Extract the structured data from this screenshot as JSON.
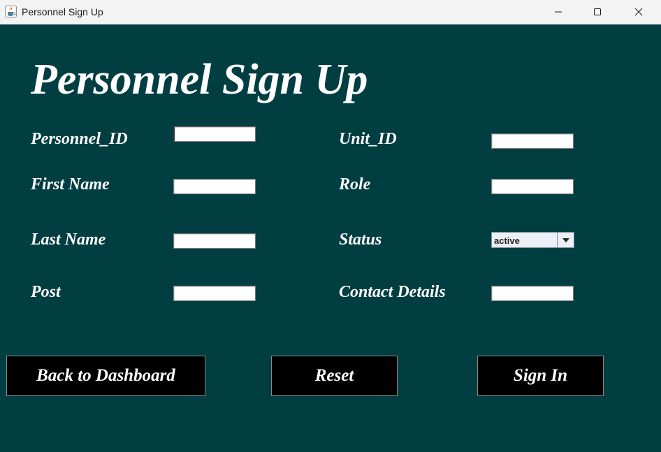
{
  "window": {
    "title": "Personnel Sign Up",
    "icon": "java-cup-icon"
  },
  "form": {
    "heading": "Personnel Sign Up",
    "fields": {
      "personnel_id": {
        "label": "Personnel_ID",
        "value": ""
      },
      "first_name": {
        "label": "First Name",
        "value": ""
      },
      "last_name": {
        "label": "Last Name",
        "value": ""
      },
      "post": {
        "label": "Post",
        "value": ""
      },
      "unit_id": {
        "label": "Unit_ID",
        "value": ""
      },
      "role": {
        "label": "Role",
        "value": ""
      },
      "status": {
        "label": "Status",
        "selected": "active"
      },
      "contact_details": {
        "label": "Contact Details",
        "value": ""
      }
    }
  },
  "buttons": {
    "back": "Back to Dashboard",
    "reset": "Reset",
    "sign_in": "Sign In"
  },
  "colors": {
    "background": "#013e42",
    "button_bg": "#000000",
    "text": "#ffffff"
  }
}
